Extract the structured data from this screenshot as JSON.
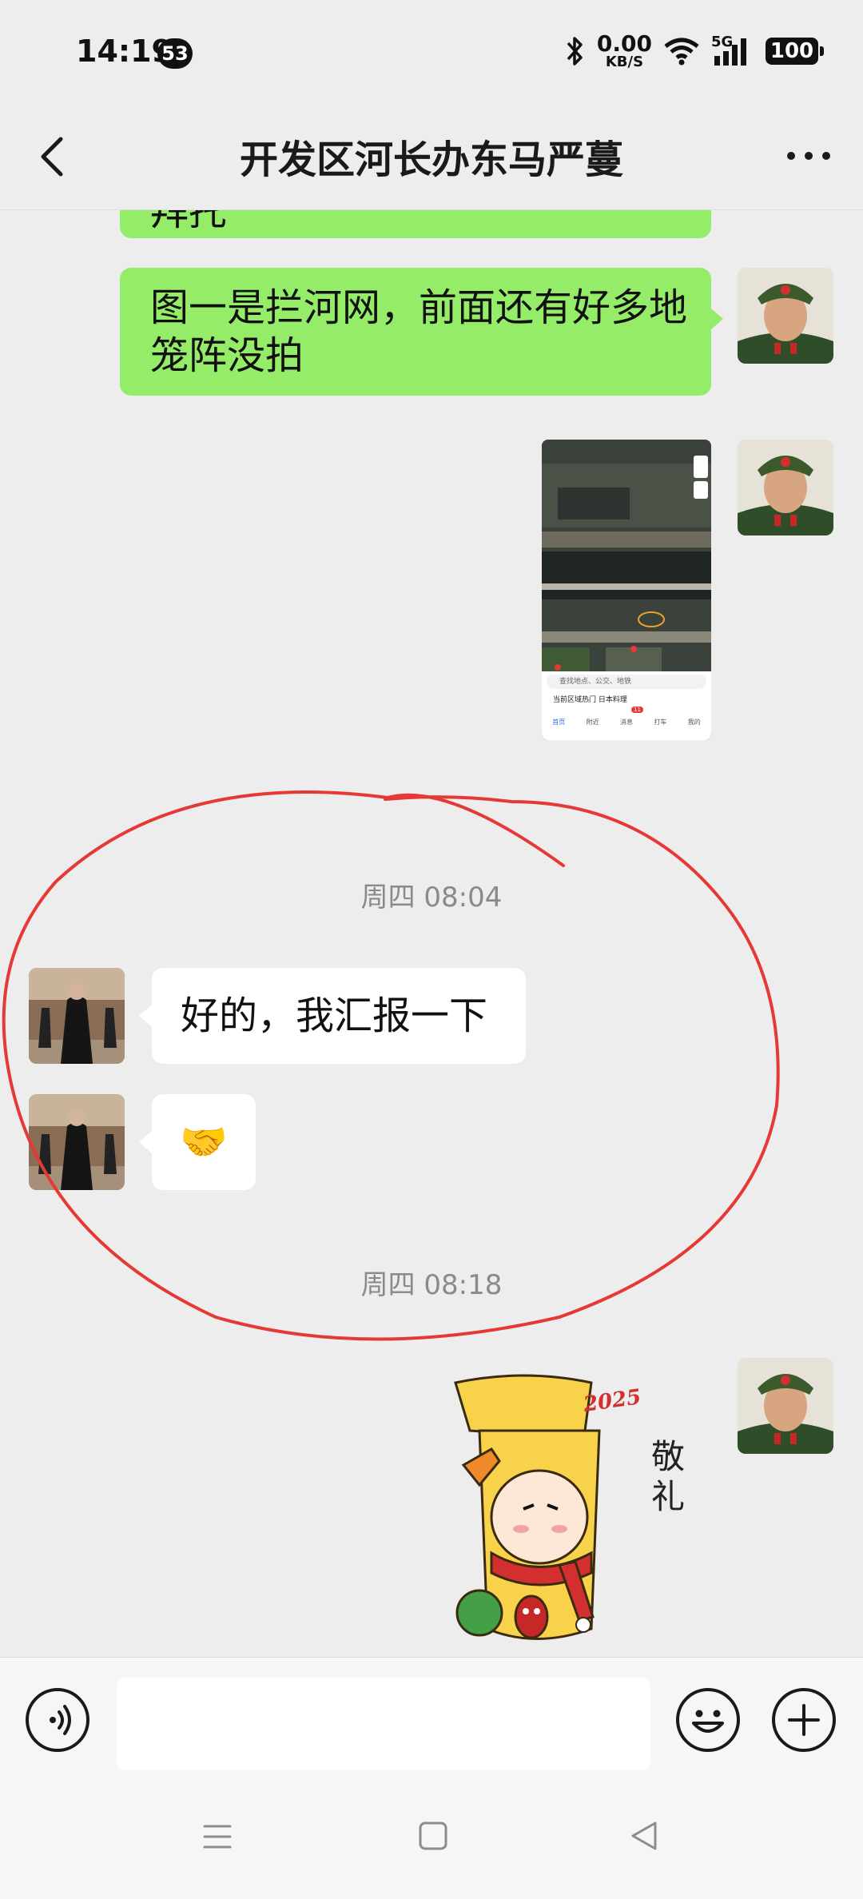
{
  "status_bar": {
    "time": "14:19",
    "notification_count": "53",
    "net_speed_value": "0.00",
    "net_speed_unit": "KB/S",
    "network_type": "5G",
    "battery": "100"
  },
  "header": {
    "title": "开发区河长办东马严蔓"
  },
  "messages": {
    "partial_text": "拜托",
    "msg1": "图一是拦河网，前面还有好多地笼阵没拍",
    "map_image": {
      "search_placeholder": "查找地点、公交、地铁",
      "hot_tip": "当前区域热门 日本料理",
      "tabs": [
        "首页",
        "附近",
        "消息",
        "打车",
        "我的"
      ],
      "badge": "11"
    },
    "timestamp1": "周四 08:04",
    "msg2": "好的，我汇报一下",
    "msg3_emoji": "🤝",
    "timestamp2": "周四 08:18",
    "sticker": {
      "year": "2025",
      "caption": "敬礼"
    }
  },
  "colors": {
    "bubble_sent": "#95ec69",
    "bubble_received": "#ffffff",
    "background": "#ededed",
    "annotation": "#e53935"
  }
}
